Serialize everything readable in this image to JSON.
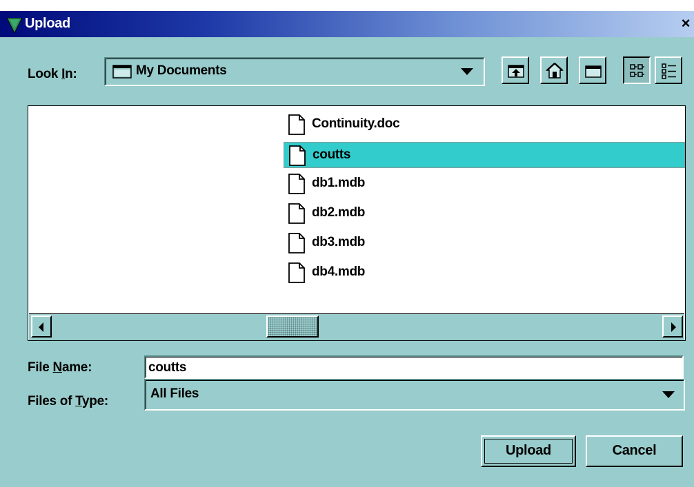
{
  "window": {
    "title": "Upload",
    "close_glyph": "×"
  },
  "look_in": {
    "label_prefix": "Look ",
    "label_mnemonic": "I",
    "label_suffix": "n:",
    "selected": "My Documents",
    "icon": "folder-icon"
  },
  "toolbar": {
    "buttons": [
      {
        "name": "up-one-level",
        "icon": "up-folder-icon"
      },
      {
        "name": "home",
        "icon": "home-icon"
      },
      {
        "name": "new-folder",
        "icon": "new-folder-icon"
      },
      {
        "name": "list-view",
        "icon": "list-view-icon",
        "pressed": true
      },
      {
        "name": "details-view",
        "icon": "details-view-icon",
        "pressed": false
      }
    ]
  },
  "files": [
    {
      "name": "Continuity.doc",
      "selected": false
    },
    {
      "name": "coutts",
      "selected": true
    },
    {
      "name": "db1.mdb",
      "selected": false
    },
    {
      "name": "db2.mdb",
      "selected": false
    },
    {
      "name": "db3.mdb",
      "selected": false
    },
    {
      "name": "db4.mdb",
      "selected": false
    }
  ],
  "file_name": {
    "label_prefix": "File ",
    "label_mnemonic": "N",
    "label_suffix": "ame:",
    "value": "coutts"
  },
  "file_type": {
    "label_prefix": "Files of ",
    "label_mnemonic": "T",
    "label_suffix": "ype:",
    "selected": "All Files"
  },
  "buttons": {
    "upload": "Upload",
    "cancel": "Cancel"
  },
  "colors": {
    "background": "#99cccc",
    "selection": "#33cccc",
    "title_gradient_start": "#000a7a"
  }
}
